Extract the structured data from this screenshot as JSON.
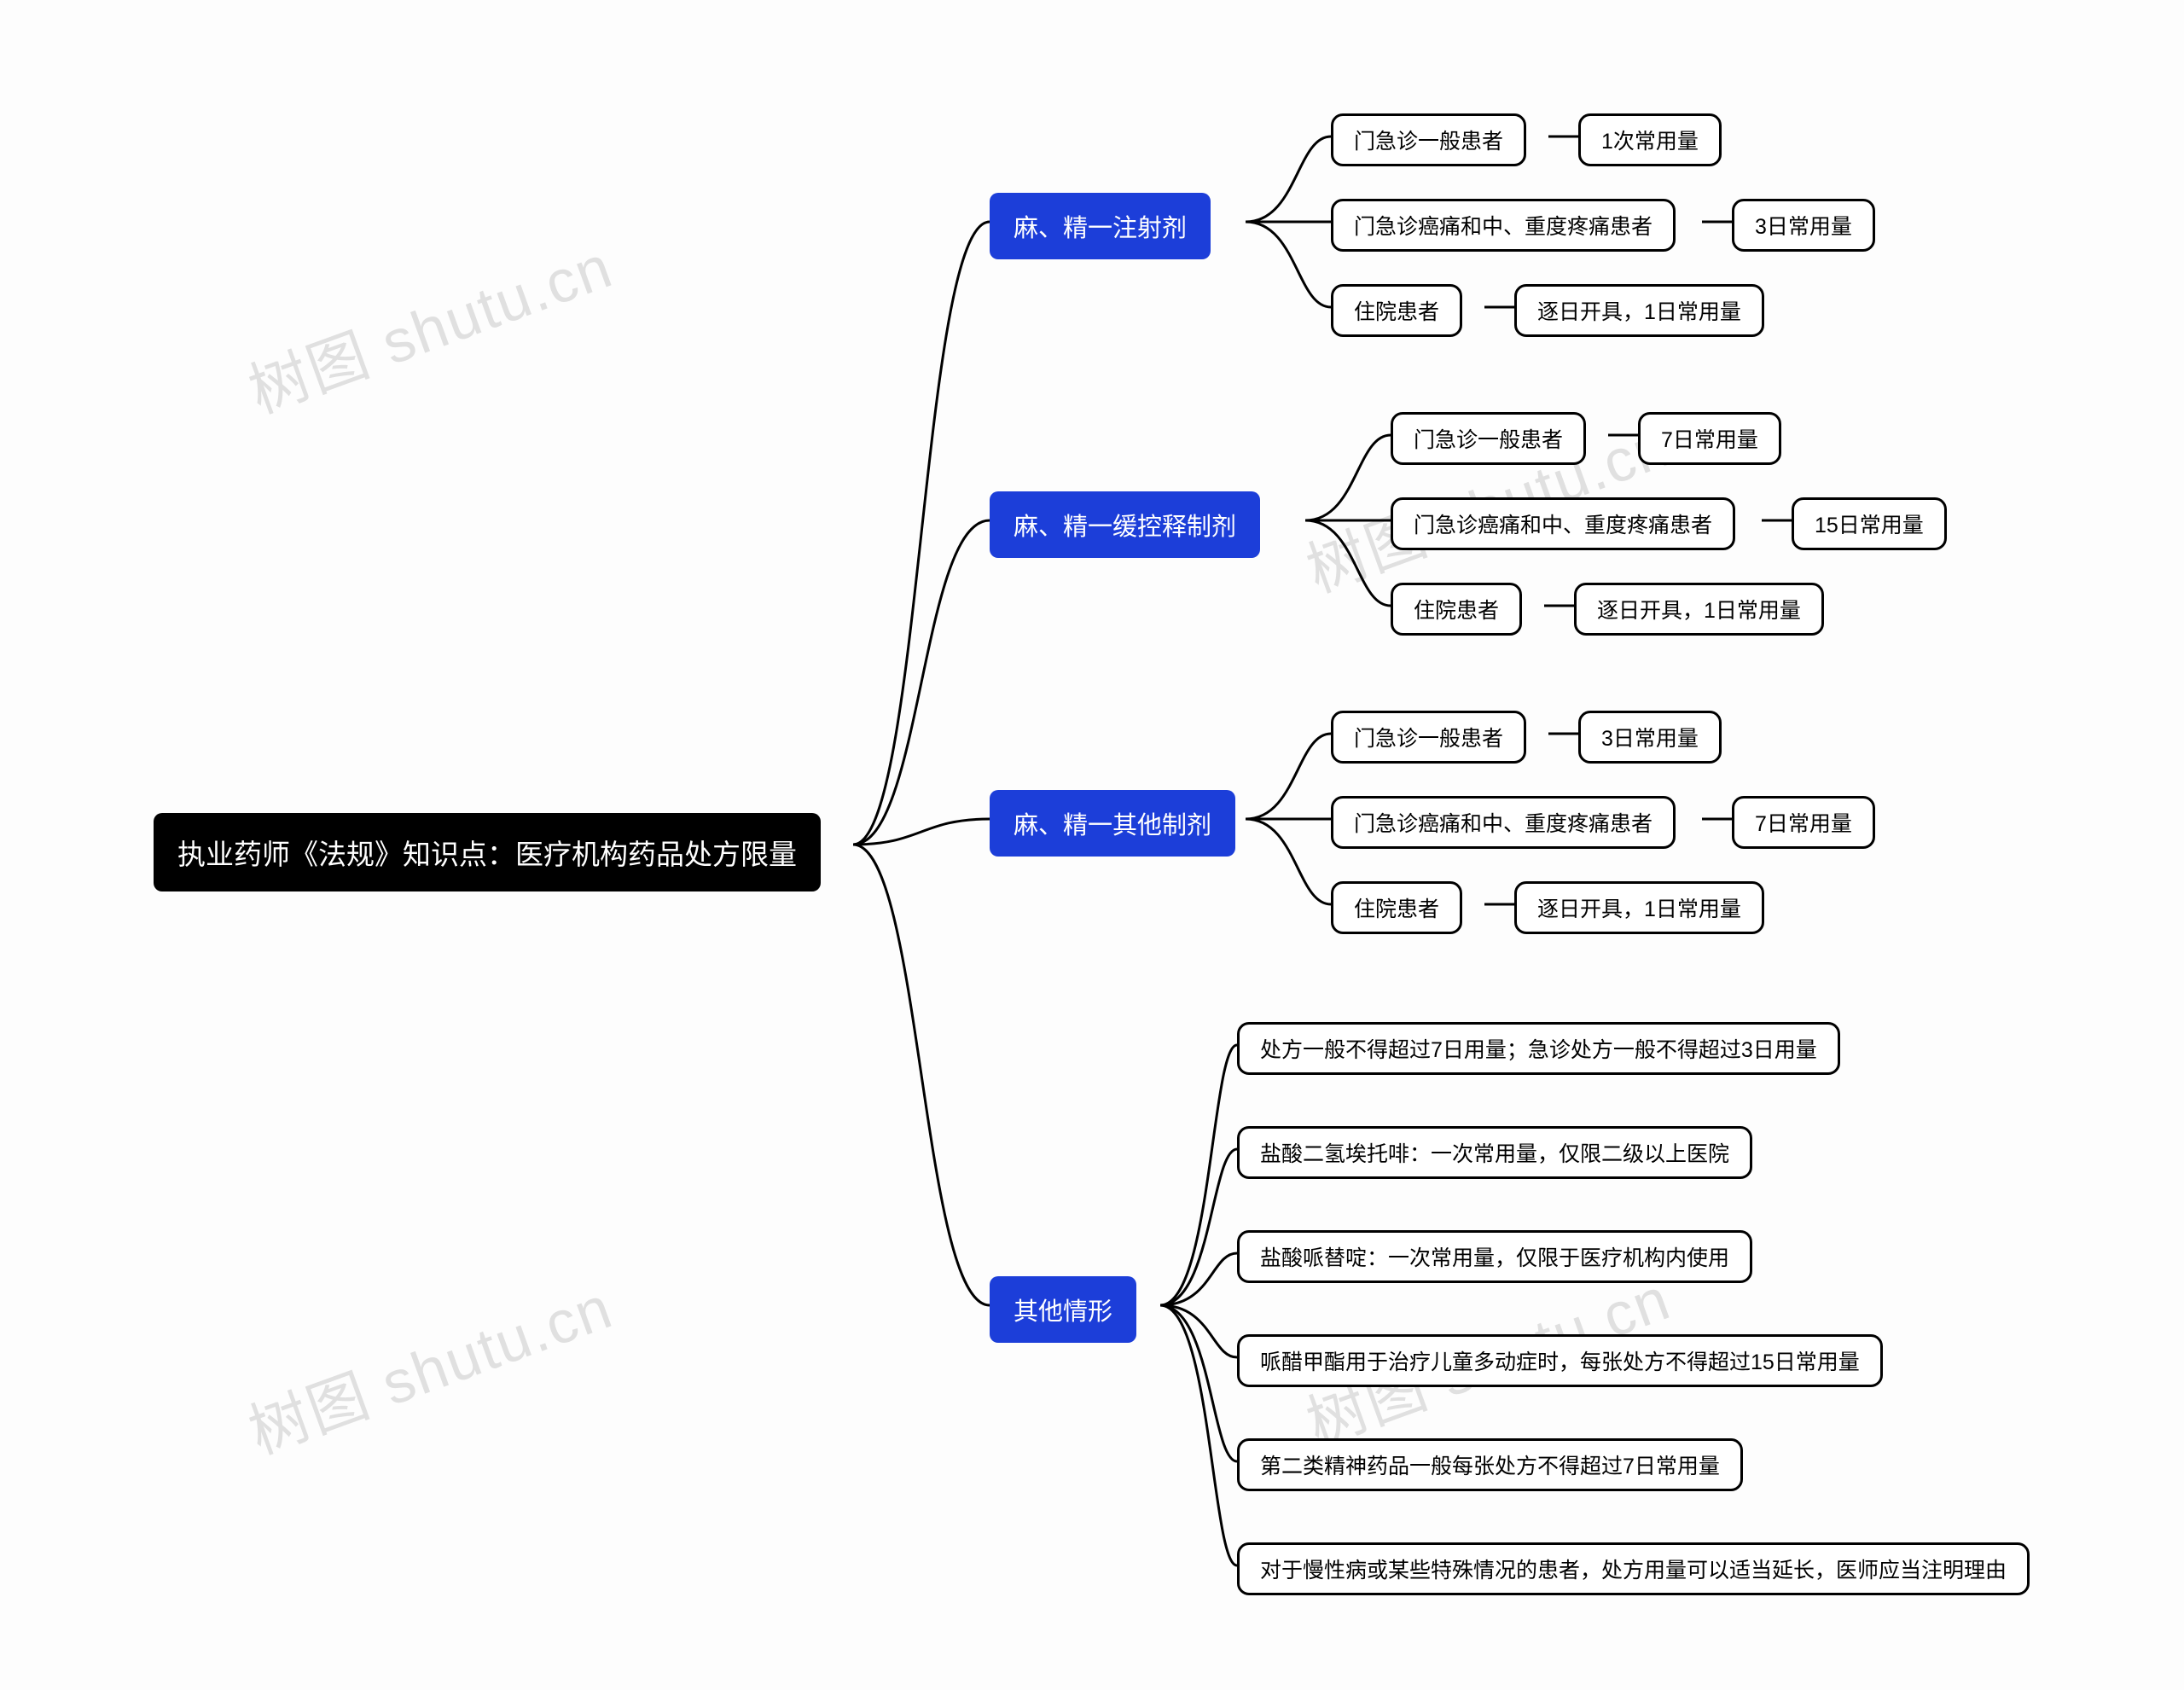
{
  "root": {
    "label": "执业药师《法规》知识点：医疗机构药品处方限量"
  },
  "categories": [
    {
      "label": "麻、精一注射剂"
    },
    {
      "label": "麻、精一缓控释制剂"
    },
    {
      "label": "麻、精一其他制剂"
    },
    {
      "label": "其他情形"
    }
  ],
  "branch1": {
    "items": [
      {
        "a": "门急诊一般患者",
        "b": "1次常用量"
      },
      {
        "a": "门急诊癌痛和中、重度疼痛患者",
        "b": "3日常用量"
      },
      {
        "a": "住院患者",
        "b": "逐日开具，1日常用量"
      }
    ]
  },
  "branch2": {
    "items": [
      {
        "a": "门急诊一般患者",
        "b": "7日常用量"
      },
      {
        "a": "门急诊癌痛和中、重度疼痛患者",
        "b": "15日常用量"
      },
      {
        "a": "住院患者",
        "b": "逐日开具，1日常用量"
      }
    ]
  },
  "branch3": {
    "items": [
      {
        "a": "门急诊一般患者",
        "b": "3日常用量"
      },
      {
        "a": "门急诊癌痛和中、重度疼痛患者",
        "b": "7日常用量"
      },
      {
        "a": "住院患者",
        "b": "逐日开具，1日常用量"
      }
    ]
  },
  "branch4": {
    "items": [
      "处方一般不得超过7日用量；急诊处方一般不得超过3日用量",
      "盐酸二氢埃托啡：一次常用量，仅限二级以上医院",
      "盐酸哌替啶：一次常用量，仅限于医疗机构内使用",
      "哌醋甲酯用于治疗儿童多动症时，每张处方不得超过15日常用量",
      "第二类精神药品一般每张处方不得超过7日常用量",
      "对于慢性病或某些特殊情况的患者，处方用量可以适当延长，医师应当注明理由"
    ]
  },
  "watermark": "树图 shutu.cn"
}
